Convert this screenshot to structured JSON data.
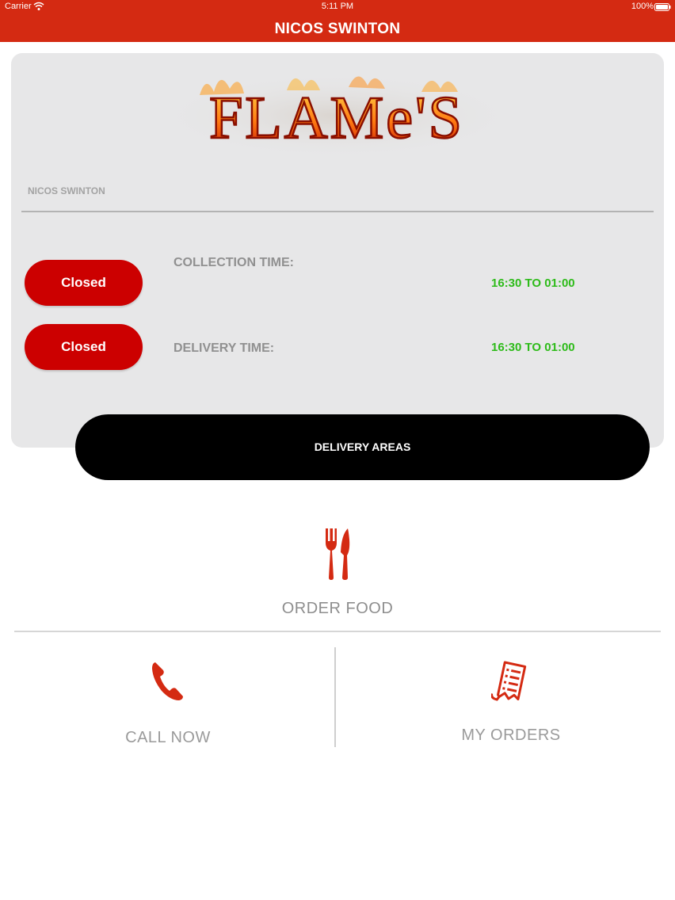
{
  "status_bar": {
    "carrier": "Carrier",
    "time": "5:11 PM",
    "battery": "100%"
  },
  "nav": {
    "title": "NICOS SWINTON"
  },
  "card": {
    "logo_text": "FLAMe'S",
    "store_name": "NICOS SWINTON",
    "collection": {
      "status": "Closed",
      "label": "COLLECTION TIME:",
      "hours": "16:30 TO 01:00"
    },
    "delivery": {
      "status": "Closed",
      "label": "DELIVERY TIME:",
      "hours": "16:30 TO 01:00"
    },
    "delivery_areas_label": "DELIVERY AREAS"
  },
  "actions": {
    "order_food": {
      "label": "ORDER FOOD",
      "icon": "fork-knife-icon"
    },
    "call_now": {
      "label": "CALL NOW",
      "icon": "phone-icon"
    },
    "my_orders": {
      "label": "MY ORDERS",
      "icon": "receipt-icon"
    }
  },
  "colors": {
    "brand_red": "#d42a12",
    "closed_red": "#cc0000",
    "hours_green": "#2dbb19",
    "card_bg": "#e7e7e8",
    "button_black": "#000000"
  }
}
